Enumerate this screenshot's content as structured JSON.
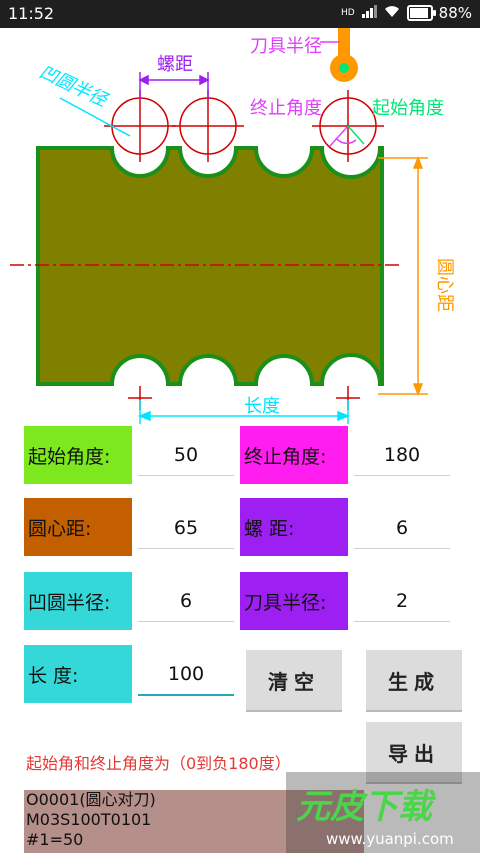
{
  "status_bar": {
    "time": "11:52",
    "network": "HD",
    "battery": "88%"
  },
  "diagram": {
    "labels": {
      "concave_radius": "凹圆半径",
      "pitch": "螺距",
      "tool_radius": "刀具半径",
      "end_angle": "终止角度",
      "start_angle": "起始角度",
      "center_distance": "圆心距",
      "length": "长度"
    },
    "colors": {
      "workpiece": "#808000",
      "outline": "#1a8f1a",
      "dim_magenta": "#e040fb",
      "dim_cyan": "#00e5ff",
      "dim_orange": "#ff9800",
      "tool": "#ff9800",
      "tool_center": "#00e676",
      "centerline": "#d00000"
    }
  },
  "form": {
    "start_angle": {
      "label": "起始角度:",
      "value": "50",
      "color": "#7ee81f"
    },
    "end_angle": {
      "label": "终止角度:",
      "value": "180",
      "color": "#ff1df0"
    },
    "center_distance": {
      "label": "圆心距:",
      "value": "65",
      "color": "#c45f00"
    },
    "pitch": {
      "label": "螺  距:",
      "value": "6",
      "color": "#9d1ff2"
    },
    "concave_radius": {
      "label": "凹圆半径:",
      "value": "6",
      "color": "#35d8d8"
    },
    "tool_radius": {
      "label": "刀具半径:",
      "value": "2",
      "color": "#9d1ff2"
    },
    "length": {
      "label": "长  度:",
      "value": "100",
      "color": "#35d8d8"
    }
  },
  "buttons": {
    "clear": "清空",
    "generate": "生成",
    "export": "导出"
  },
  "note": "起始角和终止角度为（0到负180度）",
  "output_lines": [
    "O0001(圆心对刀)",
    "M03S100T0101",
    "#1=50"
  ],
  "watermark": {
    "brand": "元皮下载",
    "url": "www.yuanpi.com"
  }
}
